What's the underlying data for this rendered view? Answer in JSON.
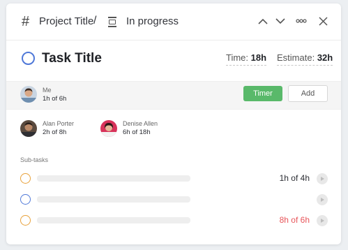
{
  "header": {
    "project_title": "Project Title",
    "separator": "/",
    "status": "In progress"
  },
  "task": {
    "title": "Task Title",
    "time_label": "Time:",
    "time_value": "18h",
    "estimate_label": "Estimate:",
    "estimate_value": "32h"
  },
  "me": {
    "name": "Me",
    "time": "1h of 6h",
    "timer_label": "Timer",
    "add_label": "Add"
  },
  "collaborators": [
    {
      "name": "Alan Porter",
      "time": "2h of 8h"
    },
    {
      "name": "Denise Allen",
      "time": "6h of 18h"
    }
  ],
  "subtasks_label": "Sub-tasks",
  "subtasks": [
    {
      "time": "1h of 4h",
      "status_color": "#e8a13a",
      "overdue": false
    },
    {
      "time": "",
      "status_color": "#4f78d8",
      "overdue": false
    },
    {
      "time": "8h of 6h",
      "status_color": "#e8a13a",
      "overdue": true
    }
  ],
  "colors": {
    "accent_blue": "#4f78d8",
    "timer_green": "#59b96a",
    "overdue_red": "#e8555a"
  }
}
